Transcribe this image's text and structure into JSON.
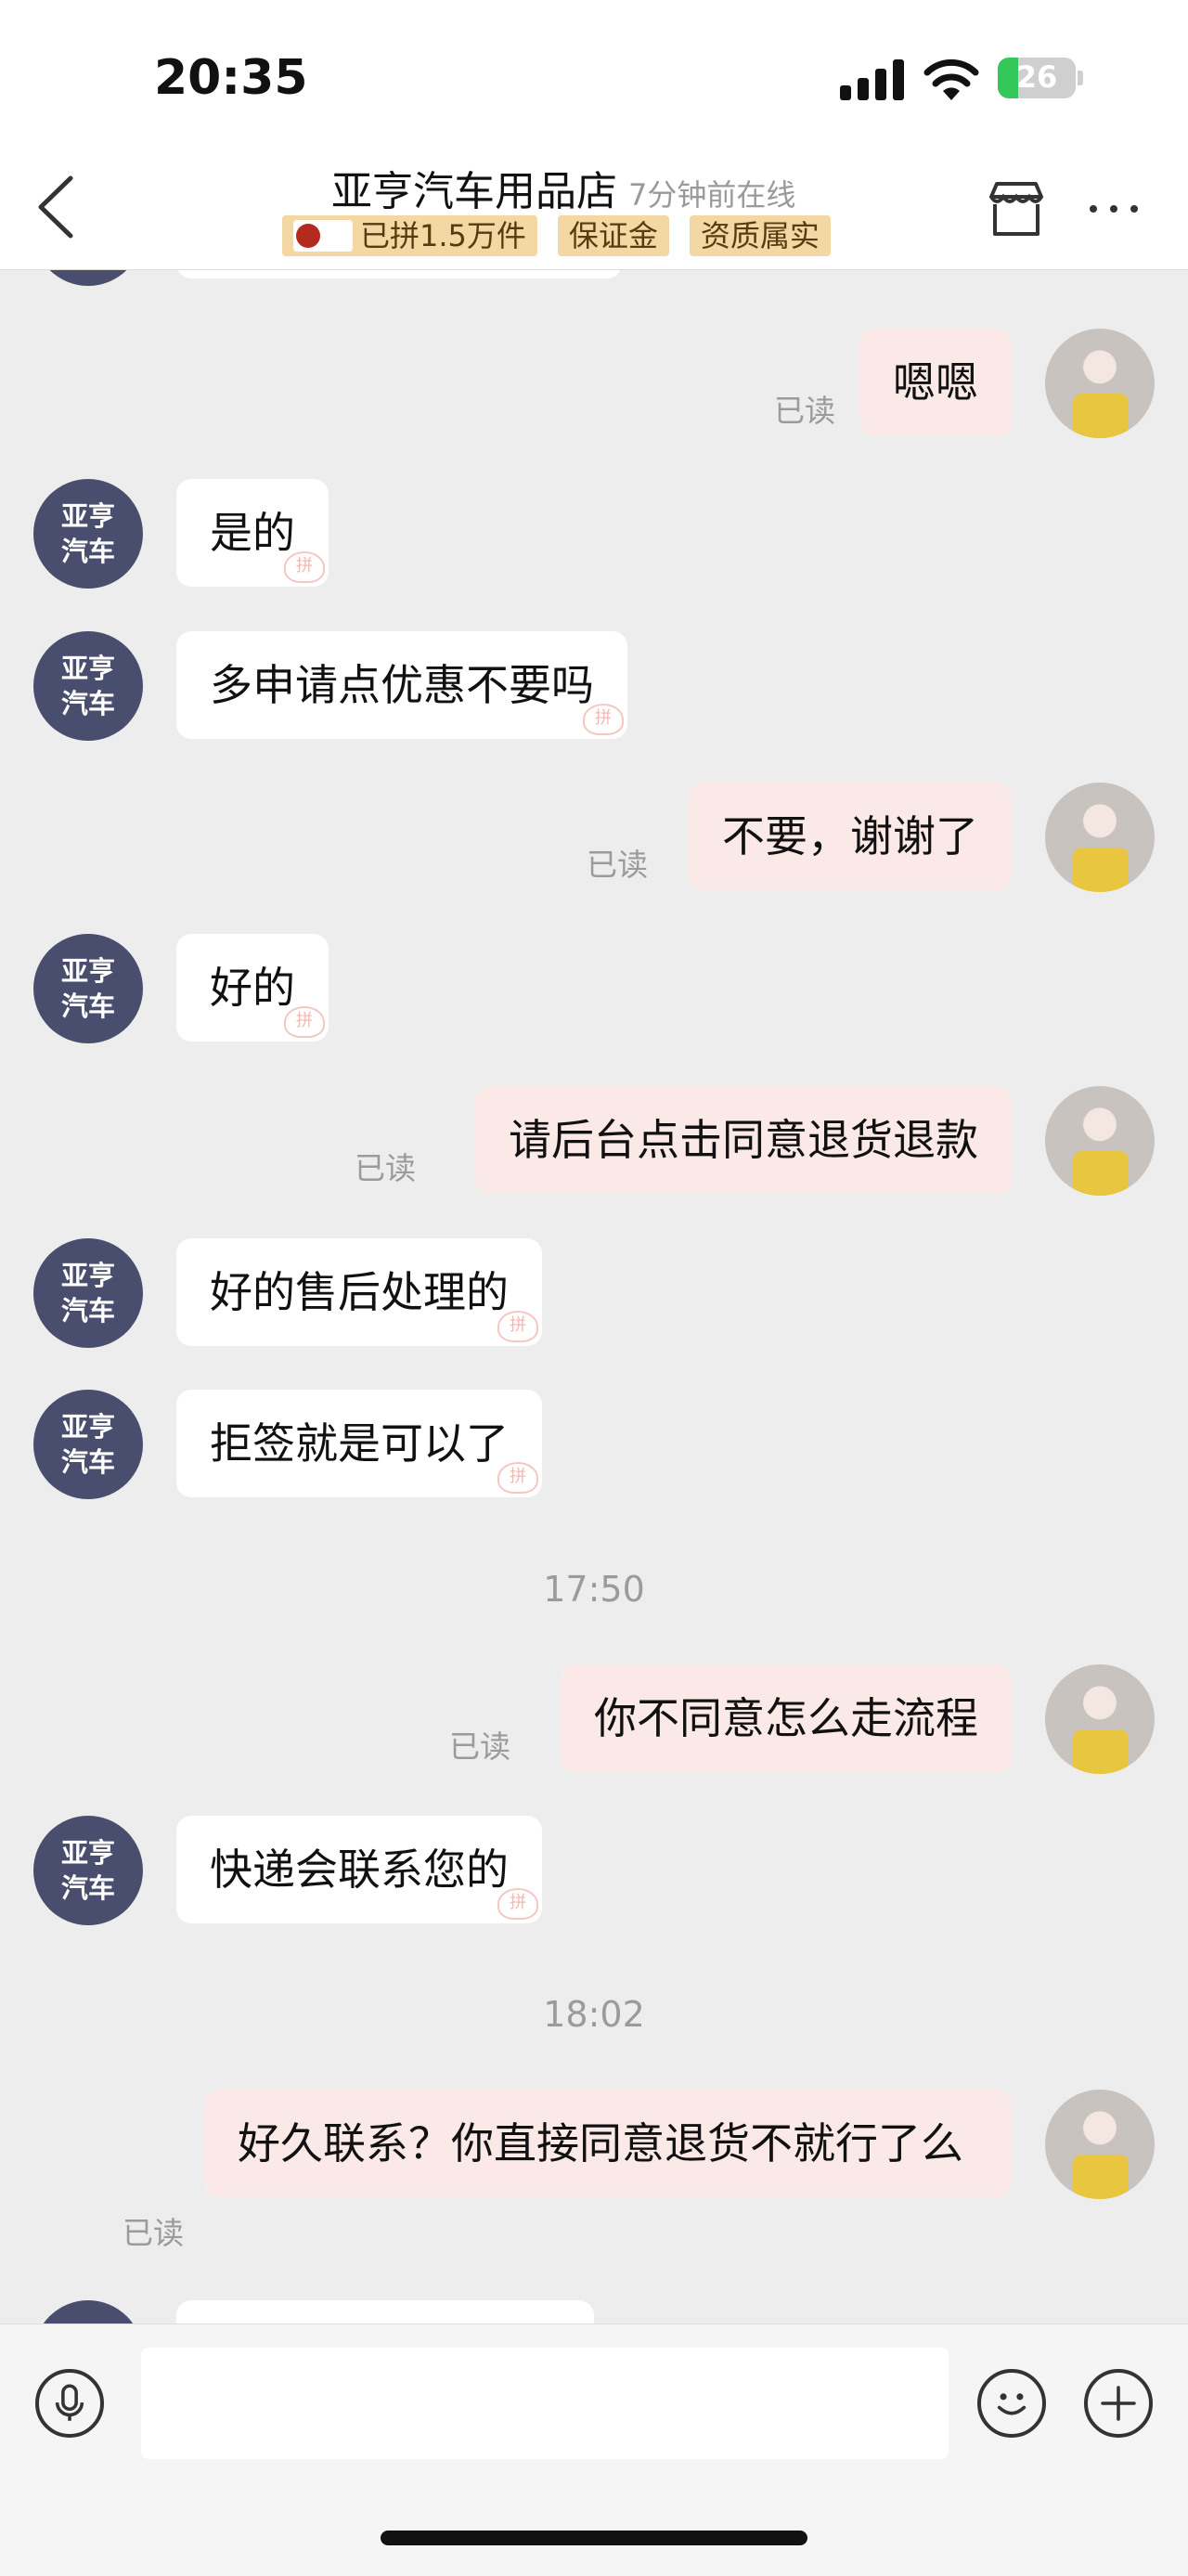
{
  "status_bar": {
    "time": "20:35",
    "battery": "26",
    "battery_level_percent": 26
  },
  "header": {
    "store_name": "亚亨汽车用品店",
    "online_status": "7分钟前在线",
    "badges": [
      "已拼1.5万件",
      "保证金",
      "资质属实"
    ]
  },
  "shop_avatar": {
    "line1": "亚亨",
    "line2": "汽车"
  },
  "read_label": "已读",
  "messages": [
    {
      "side": "right",
      "text": "嗯嗯",
      "read": "已读"
    },
    {
      "side": "left",
      "text": "是的"
    },
    {
      "side": "left",
      "text": "多申请点优惠不要吗"
    },
    {
      "side": "right",
      "text": "不要，谢谢了",
      "read": "已读"
    },
    {
      "side": "left",
      "text": "好的"
    },
    {
      "side": "right",
      "text": "请后台点击同意退货退款",
      "read": "已读"
    },
    {
      "side": "left",
      "text": "好的售后处理的"
    },
    {
      "side": "left",
      "text": "拒签就是可以了"
    },
    {
      "side": "time",
      "text": "17:50"
    },
    {
      "side": "right",
      "text": "你不同意怎么走流程",
      "read": "已读"
    },
    {
      "side": "left",
      "text": "快递会联系您的"
    },
    {
      "side": "time",
      "text": "18:02"
    },
    {
      "side": "right",
      "text": "好久联系？你直接同意退货不就行了么",
      "read": "已读"
    }
  ],
  "colors": {
    "shop_avatar_bg": "#4a4e6e",
    "my_bubble_bg": "#fbe9e7",
    "shop_bubble_bg": "#ffffff",
    "badge_bg": "#f3d8a4",
    "page_bg": "#ededed"
  },
  "icons": [
    "back-arrow-icon",
    "store-icon",
    "more-icon",
    "voice-icon",
    "emoji-icon",
    "plus-icon"
  ]
}
